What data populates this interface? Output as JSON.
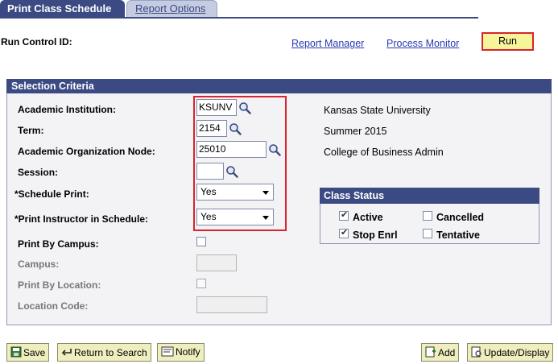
{
  "tabs": [
    {
      "label": "Print Class Schedule",
      "active": true
    },
    {
      "label": "Report Options",
      "active": false
    }
  ],
  "header": {
    "run_control_label": "Run Control ID:",
    "run_control_value": "",
    "report_manager": "Report Manager",
    "process_monitor": "Process Monitor",
    "run_label": "Run"
  },
  "selection": {
    "title": "Selection Criteria",
    "institution": {
      "label": "Academic Institution:",
      "value": "KSUNV",
      "desc": "Kansas State University"
    },
    "term": {
      "label": "Term:",
      "value": "2154",
      "desc": "Summer 2015"
    },
    "org_node": {
      "label": "Academic Organization Node:",
      "value": "25010",
      "desc": "College of Business Admin"
    },
    "session": {
      "label": "Session:",
      "value": ""
    },
    "schedule_print": {
      "label": "*Schedule Print:",
      "value": "Yes"
    },
    "print_instructor": {
      "label": "*Print Instructor in Schedule:",
      "value": "Yes"
    },
    "print_by_campus": {
      "label": "Print By Campus:",
      "checked": false
    },
    "campus": {
      "label": "Campus:",
      "value": ""
    },
    "print_by_location": {
      "label": "Print By Location:",
      "checked": false
    },
    "location_code": {
      "label": "Location Code:",
      "value": ""
    }
  },
  "class_status": {
    "title": "Class Status",
    "active": {
      "label": "Active",
      "checked": true
    },
    "cancelled": {
      "label": "Cancelled",
      "checked": false
    },
    "stop_enrl": {
      "label": "Stop Enrl",
      "checked": true
    },
    "tentative": {
      "label": "Tentative",
      "checked": false
    }
  },
  "toolbar": {
    "save": "Save",
    "return_to_search": "Return to Search",
    "notify": "Notify",
    "add": "Add",
    "update_display": "Update/Display"
  },
  "colors": {
    "header_bg": "#3b4a82",
    "highlight_red": "#d9232e",
    "run_button_bg": "#f8f49a",
    "link": "#2a3ab0",
    "button_bg": "#efeebf"
  },
  "icons": {
    "lookup": "magnifier-icon",
    "save": "floppy-icon",
    "return": "return-arrow-icon",
    "notify": "notify-icon",
    "add": "add-icon",
    "update": "update-display-icon"
  }
}
